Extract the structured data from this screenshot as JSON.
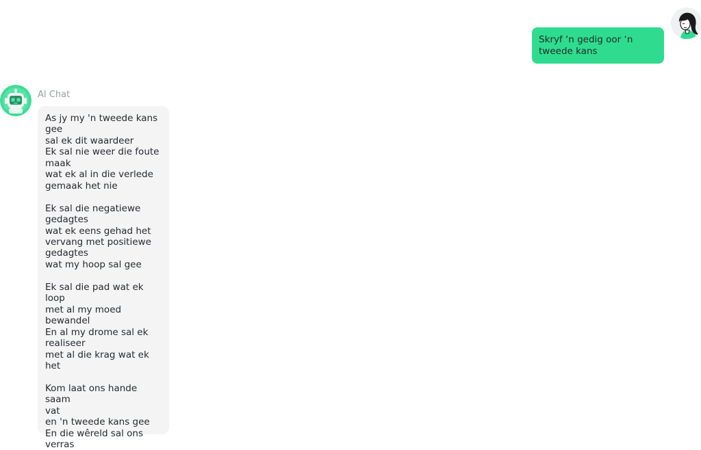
{
  "user_message": {
    "text": "Skryf ‘n gedig oor ‘n\ntweede kans"
  },
  "bot": {
    "name": "AI Chat",
    "reply": "As jy my 'n tweede kans\ngee\nsal ek dit waardeer\nEk sal nie weer die foute\nmaak\nwat ek al in die verlede\ngemaak het nie\n\nEk sal die negatiewe\ngedagtes\nwat ek eens gehad het\nvervang met positiewe\ngedagtes\nwat my hoop sal gee\n\nEk sal die pad wat ek loop\nmet al my moed bewandel\nEn al my drome sal ek\nrealiseer\nmet al die krag wat ek het\n\nKom laat ons hande saam\nvat\nen 'n tweede kans gee\nEn die wêreld sal ons\nverras\nas ons dit saam kan\nbereik"
  },
  "icons": {
    "user_avatar": "woman-avatar-icon",
    "bot_avatar": "robot-avatar-icon"
  },
  "colors": {
    "user_bubble": "#2fdc8f",
    "bot_bubble": "#f4f4f5",
    "bot_avatar": "#3ddc97"
  }
}
